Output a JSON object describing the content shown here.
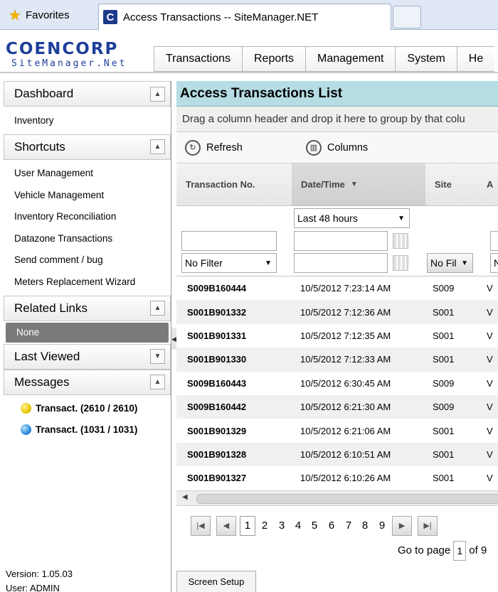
{
  "browser": {
    "favorites_label": "Favorites",
    "tab_title": "Access Transactions -- SiteManager.NET",
    "tab_icon_letter": "C"
  },
  "logo": {
    "main": "COENCORP",
    "sub": "SiteManager.Net"
  },
  "topnav": [
    "Transactions",
    "Reports",
    "Management",
    "System",
    "He"
  ],
  "sidebar": {
    "dashboard": {
      "title": "Dashboard",
      "items": [
        "Inventory"
      ]
    },
    "shortcuts": {
      "title": "Shortcuts",
      "items": [
        "User Management",
        "Vehicle Management",
        "Inventory Reconciliation",
        "Datazone Transactions",
        "Send comment / bug",
        "Meters Replacement Wizard"
      ]
    },
    "related_links": {
      "title": "Related Links",
      "items": [
        "None"
      ]
    },
    "last_viewed": {
      "title": "Last Viewed"
    },
    "messages": {
      "title": "Messages",
      "items": [
        {
          "label": "Transact. (2610 / 2610)",
          "color": "#e8c600"
        },
        {
          "label": "Transact. (1031 / 1031)",
          "color": "#2b8cdf"
        }
      ]
    },
    "version": "Version: 1.05.03",
    "user": "User: ADMIN"
  },
  "main": {
    "title": "Access Transactions List",
    "group_hint": "Drag a column header and drop it here to group by that colu",
    "toolbar": {
      "refresh": "Refresh",
      "columns": "Columns"
    },
    "columns": [
      "Transaction No.",
      "Date/Time",
      "Site",
      "A"
    ],
    "filters": {
      "date_range": "Last 48 hours",
      "no_filter": "No Filter",
      "site_filter": "No Fil",
      "extra_filter": "N"
    },
    "rows": [
      {
        "txn": "S009B160444",
        "dt": "10/5/2012 7:23:14 AM",
        "site": "S009",
        "extra": "V"
      },
      {
        "txn": "S001B901332",
        "dt": "10/5/2012 7:12:36 AM",
        "site": "S001",
        "extra": "V"
      },
      {
        "txn": "S001B901331",
        "dt": "10/5/2012 7:12:35 AM",
        "site": "S001",
        "extra": "V"
      },
      {
        "txn": "S001B901330",
        "dt": "10/5/2012 7:12:33 AM",
        "site": "S001",
        "extra": "V"
      },
      {
        "txn": "S009B160443",
        "dt": "10/5/2012 6:30:45 AM",
        "site": "S009",
        "extra": "V"
      },
      {
        "txn": "S009B160442",
        "dt": "10/5/2012 6:21:30 AM",
        "site": "S009",
        "extra": "V"
      },
      {
        "txn": "S001B901329",
        "dt": "10/5/2012 6:21:06 AM",
        "site": "S001",
        "extra": "V"
      },
      {
        "txn": "S001B901328",
        "dt": "10/5/2012 6:10:51 AM",
        "site": "S001",
        "extra": "V"
      },
      {
        "txn": "S001B901327",
        "dt": "10/5/2012 6:10:26 AM",
        "site": "S001",
        "extra": "V"
      }
    ],
    "pager": {
      "pages": [
        "1",
        "2",
        "3",
        "4",
        "5",
        "6",
        "7",
        "8",
        "9"
      ],
      "current": "1",
      "goto_label": "Go to page",
      "goto_value": "1",
      "of_label": "of 9"
    },
    "screen_setup": "Screen Setup"
  }
}
